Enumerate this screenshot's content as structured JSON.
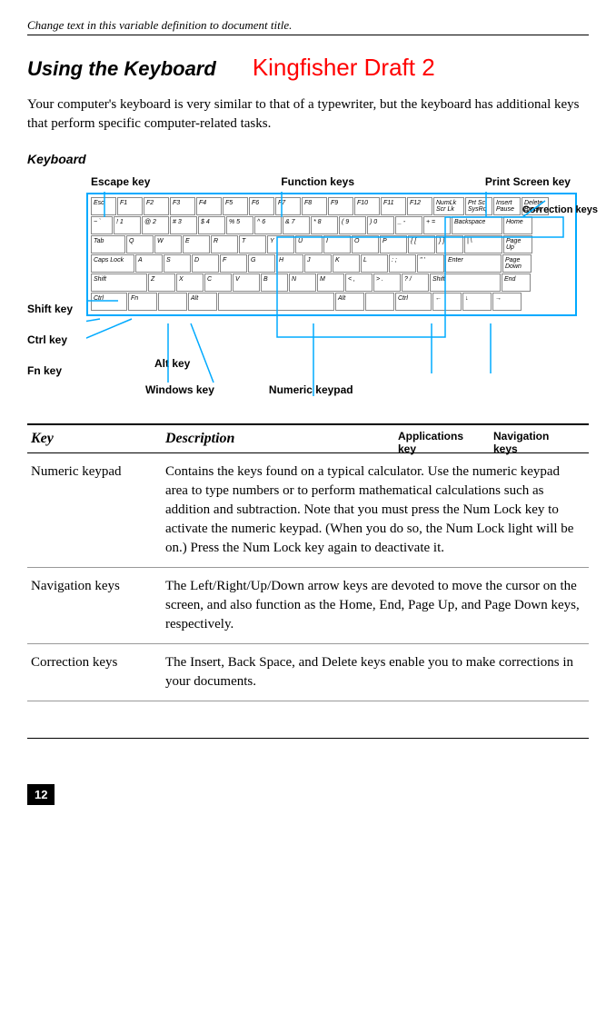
{
  "header_note": "Change text in this variable definition to document title.",
  "section_title": "Using the Keyboard",
  "draft_label": "Kingfisher Draft 2",
  "intro_text": "Your computer's keyboard is very similar to that of a typewriter, but the keyboard has additional keys that perform specific computer-related tasks.",
  "subheading": "Keyboard",
  "labels": {
    "escape": "Escape key",
    "function": "Function keys",
    "printscreen": "Print Screen key",
    "correction": "Correction keys",
    "shift": "Shift key",
    "ctrl": "Ctrl key",
    "fn": "Fn key",
    "alt": "Alt key",
    "windows": "Windows key",
    "numeric": "Numeric keypad",
    "applications": "Applications key",
    "navigation": "Navigation keys"
  },
  "keys": {
    "row1": [
      "Esc",
      "F1",
      "F2",
      "F3",
      "F4",
      "F5",
      "F6",
      "F7",
      "F8",
      "F9",
      "F10",
      "F11",
      "F12",
      "NumLk Scr Lk",
      "Prt Sc SysRq",
      "Insert Pause",
      "Delete Break"
    ],
    "row2": [
      "~ `",
      "! 1",
      "@ 2",
      "# 3",
      "$ 4",
      "% 5",
      "^ 6",
      "& 7",
      "* 8",
      "( 9",
      ") 0",
      "_ -",
      "+ =",
      "Backspace",
      "Home"
    ],
    "row3": [
      "Tab",
      "Q",
      "W",
      "E",
      "R",
      "T",
      "Y",
      "U",
      "I",
      "O",
      "P",
      "{ [",
      "} ]",
      "| \\",
      "Page Up"
    ],
    "row4": [
      "Caps Lock",
      "A",
      "S",
      "D",
      "F",
      "G",
      "H",
      "J",
      "K",
      "L",
      ": ;",
      "\" '",
      "Enter",
      "Page Down"
    ],
    "row5": [
      "Shift",
      "Z",
      "X",
      "C",
      "V",
      "B",
      "N",
      "M",
      "< ,",
      "> .",
      "? /",
      "Shift",
      "End"
    ],
    "row6": [
      "Ctrl",
      "Fn",
      "",
      "Alt",
      "",
      "Alt",
      "",
      "Ctrl",
      "←",
      "↓",
      "→"
    ]
  },
  "table": {
    "header_key": "Key",
    "header_desc": "Description",
    "rows": [
      {
        "key": "Numeric keypad",
        "desc": "Contains the keys found on a typical calculator. Use the numeric keypad area to type numbers or to perform mathematical calculations such as addition and subtraction. Note that you must press the Num Lock key to activate the numeric keypad. (When you do so, the Num Lock light will be on.) Press the Num Lock key again to deactivate it."
      },
      {
        "key": "Navigation keys",
        "desc": "The Left/Right/Up/Down arrow keys are devoted to move the cursor on the screen, and also function as the Home, End, Page Up, and Page Down keys, respectively."
      },
      {
        "key": "Correction keys",
        "desc": "The Insert, Back Space, and Delete keys enable you to make corrections in your documents."
      }
    ]
  },
  "page_number": "12"
}
